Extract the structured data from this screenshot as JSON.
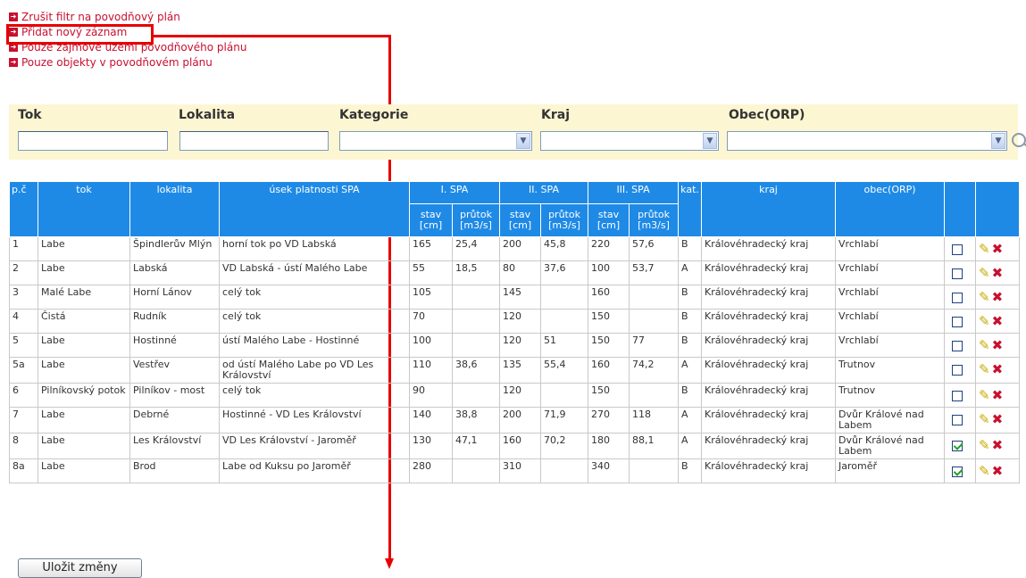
{
  "links": [
    {
      "label": "Zrušit filtr na povodňový plán"
    },
    {
      "label": "Přidat nový záznam"
    },
    {
      "label": "Pouze zájmové území povodňového plánu"
    },
    {
      "label": "Pouze objekty v povodňovém plánu"
    }
  ],
  "filters": {
    "tok": "Tok",
    "lokalita": "Lokalita",
    "kategorie": "Kategorie",
    "kraj": "Kraj",
    "obec": "Obec(ORP)"
  },
  "table": {
    "headers": {
      "pc": "p.č",
      "tok": "tok",
      "lokalita": "lokalita",
      "usek": "úsek platnosti SPA",
      "spa1": "I. SPA",
      "spa2": "II. SPA",
      "spa3": "III. SPA",
      "kat": "kat.",
      "kraj": "kraj",
      "obec": "obec(ORP)",
      "stav": "stav [cm]",
      "prutok": "průtok [m3/s]"
    },
    "rows": [
      {
        "pc": "1",
        "tok": "Labe",
        "lokalita": "Špindlerův Mlýn",
        "usek": "horní tok po VD Labská",
        "s1": "165",
        "p1": "25,4",
        "s2": "200",
        "p2": "45,8",
        "s3": "220",
        "p3": "57,6",
        "kat": "B",
        "kraj": "Královéhradecký kraj",
        "obec": "Vrchlabí",
        "checked": false
      },
      {
        "pc": "2",
        "tok": "Labe",
        "lokalita": "Labská",
        "usek": "VD Labská - ústí Malého Labe",
        "s1": "55",
        "p1": "18,5",
        "s2": "80",
        "p2": "37,6",
        "s3": "100",
        "p3": "53,7",
        "kat": "A",
        "kraj": "Královéhradecký kraj",
        "obec": "Vrchlabí",
        "checked": false
      },
      {
        "pc": "3",
        "tok": "Malé Labe",
        "lokalita": "Horní Lánov",
        "usek": "celý tok",
        "s1": "105",
        "p1": "",
        "s2": "145",
        "p2": "",
        "s3": "160",
        "p3": "",
        "kat": "B",
        "kraj": "Královéhradecký kraj",
        "obec": "Vrchlabí",
        "checked": false
      },
      {
        "pc": "4",
        "tok": "Čistá",
        "lokalita": "Rudník",
        "usek": "celý tok",
        "s1": "70",
        "p1": "",
        "s2": "120",
        "p2": "",
        "s3": "150",
        "p3": "",
        "kat": "B",
        "kraj": "Královéhradecký kraj",
        "obec": "Vrchlabí",
        "checked": false
      },
      {
        "pc": "5",
        "tok": "Labe",
        "lokalita": "Hostinné",
        "usek": "ústí Malého Labe - Hostinné",
        "s1": "100",
        "p1": "",
        "s2": "120",
        "p2": "51",
        "s3": "150",
        "p3": "77",
        "kat": "B",
        "kraj": "Královéhradecký kraj",
        "obec": "Vrchlabí",
        "checked": false
      },
      {
        "pc": "5a",
        "tok": "Labe",
        "lokalita": "Vestřev",
        "usek": "od ústí Malého Labe po VD Les Království",
        "s1": "110",
        "p1": "38,6",
        "s2": "135",
        "p2": "55,4",
        "s3": "160",
        "p3": "74,2",
        "kat": "A",
        "kraj": "Královéhradecký kraj",
        "obec": "Trutnov",
        "checked": false
      },
      {
        "pc": "6",
        "tok": "Pilníkovský potok",
        "lokalita": "Pilníkov - most",
        "usek": "celý tok",
        "s1": "90",
        "p1": "",
        "s2": "120",
        "p2": "",
        "s3": "150",
        "p3": "",
        "kat": "B",
        "kraj": "Královéhradecký kraj",
        "obec": "Trutnov",
        "checked": false
      },
      {
        "pc": "7",
        "tok": "Labe",
        "lokalita": "Debrné",
        "usek": "Hostinné - VD Les Království",
        "s1": "140",
        "p1": "38,8",
        "s2": "200",
        "p2": "71,9",
        "s3": "270",
        "p3": "118",
        "kat": "A",
        "kraj": "Královéhradecký kraj",
        "obec": "Dvůr Králové nad Labem",
        "checked": false
      },
      {
        "pc": "8",
        "tok": "Labe",
        "lokalita": "Les Království",
        "usek": "VD Les Království - Jaroměř",
        "s1": "130",
        "p1": "47,1",
        "s2": "160",
        "p2": "70,2",
        "s3": "180",
        "p3": "88,1",
        "kat": "A",
        "kraj": "Královéhradecký kraj",
        "obec": "Dvůr Králové nad Labem",
        "checked": true
      },
      {
        "pc": "8a",
        "tok": "Labe",
        "lokalita": "Brod",
        "usek": "Labe od Kuksu po Jaroměř",
        "s1": "280",
        "p1": "",
        "s2": "310",
        "p2": "",
        "s3": "340",
        "p3": "",
        "kat": "B",
        "kraj": "Královéhradecký kraj",
        "obec": "Jaroměř",
        "checked": true
      }
    ]
  },
  "save_button": "Uložit změny",
  "colors": {
    "accent": "#c8102e",
    "header": "#1f8ae6",
    "filter_bg": "#fdf6d3",
    "annotation": "#e60000"
  }
}
